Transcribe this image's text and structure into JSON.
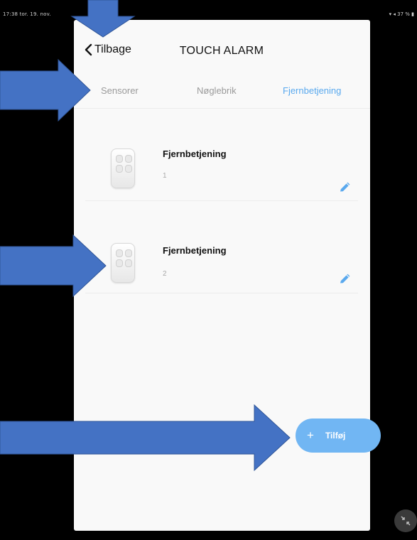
{
  "status_bar": {
    "left": "17:38  tor. 19. nov.",
    "right": "▾ ◂ 37 % ▮"
  },
  "nav": {
    "back_label": "Tilbage",
    "title": "TOUCH ALARM"
  },
  "tabs": [
    {
      "label": "Sensorer",
      "active": false
    },
    {
      "label": "Nøglebrik",
      "active": false
    },
    {
      "label": "Fjernbetjening",
      "active": true
    }
  ],
  "devices": [
    {
      "name": "Fjernbetjening",
      "number": "1"
    },
    {
      "name": "Fjernbetjening",
      "number": "2"
    }
  ],
  "add_button": {
    "plus": "+",
    "label": "Tilføj"
  },
  "colors": {
    "accent": "#5aa9ee",
    "add_button": "#71b6f3",
    "annotation_arrow": "#4472c4"
  }
}
